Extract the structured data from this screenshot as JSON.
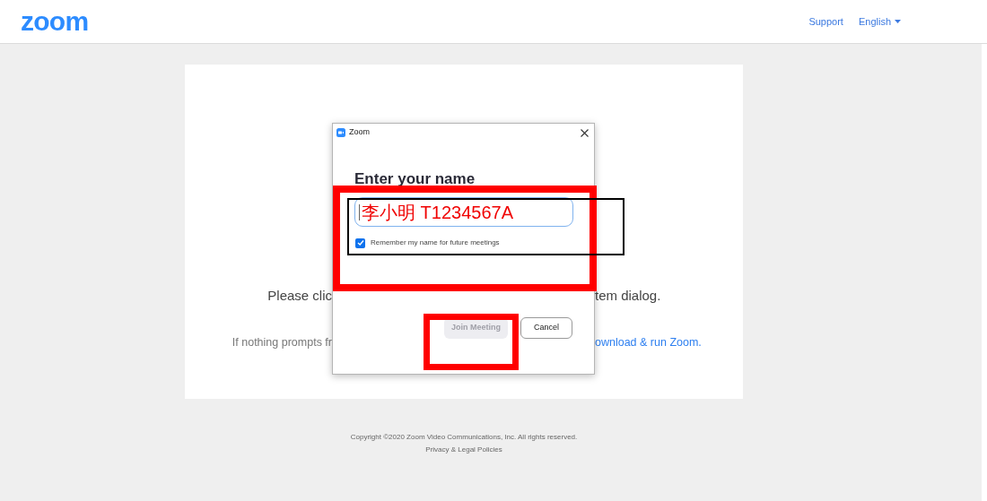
{
  "header": {
    "logo": "zoom",
    "links": [
      {
        "label": "Support",
        "dropdown": false
      },
      {
        "label": "English",
        "dropdown": true
      }
    ]
  },
  "page": {
    "line_1_left": "Please clic",
    "line_1_right": "tem dialog.",
    "line_2_left": "If nothing prompts fr",
    "line_2_link": "ownload & run Zoom."
  },
  "dialog": {
    "title": "Zoom",
    "heading": "Enter your name",
    "name_value": "李小明 T1234567A",
    "remember": {
      "label": "Remember my name for future meetings",
      "checked": true
    },
    "buttons": [
      {
        "label": "Join Meeting",
        "disabled": true
      },
      {
        "label": "Cancel",
        "disabled": false
      }
    ]
  },
  "footer": {
    "copyright": "Copyright ©2020 Zoom Video Communications, Inc. All rights reserved.",
    "link": "Privacy & Legal Policies"
  }
}
